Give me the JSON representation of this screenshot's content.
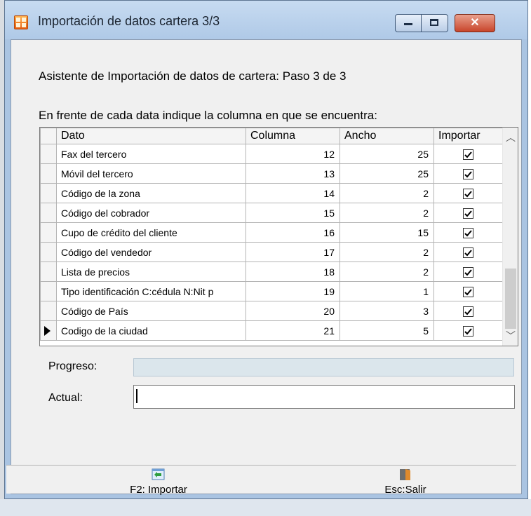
{
  "window": {
    "title": "Importación de datos cartera 3/3",
    "buttons": {
      "minimize": "minimize",
      "maximize": "maximize",
      "close": "close"
    }
  },
  "wizard": {
    "step_text": "Asistente de Importación de datos de cartera: Paso 3 de 3",
    "instruction": "En frente de cada data indique la columna en que se encuentra:"
  },
  "grid": {
    "columns": [
      "Dato",
      "Columna",
      "Ancho",
      "Importar"
    ],
    "rows": [
      {
        "dato": "Fax del tercero",
        "columna": "12",
        "ancho": "25",
        "importar": true,
        "current": false
      },
      {
        "dato": "Móvil del tercero",
        "columna": "13",
        "ancho": "25",
        "importar": true,
        "current": false
      },
      {
        "dato": "Código de la zona",
        "columna": "14",
        "ancho": "2",
        "importar": true,
        "current": false
      },
      {
        "dato": "Código del cobrador",
        "columna": "15",
        "ancho": "2",
        "importar": true,
        "current": false
      },
      {
        "dato": "Cupo de crédito del cliente",
        "columna": "16",
        "ancho": "15",
        "importar": true,
        "current": false
      },
      {
        "dato": "Código del vendedor",
        "columna": "17",
        "ancho": "2",
        "importar": true,
        "current": false
      },
      {
        "dato": "Lista de precios",
        "columna": "18",
        "ancho": "2",
        "importar": true,
        "current": false
      },
      {
        "dato": "Tipo identificación C:cédula N:Nit p",
        "columna": "19",
        "ancho": "1",
        "importar": true,
        "current": false
      },
      {
        "dato": "Código de País",
        "columna": "20",
        "ancho": "3",
        "importar": true,
        "current": false
      },
      {
        "dato": "Codigo de la ciudad",
        "columna": "21",
        "ancho": "5",
        "importar": true,
        "current": true
      }
    ]
  },
  "form": {
    "progress_label": "Progreso:",
    "progress_value": 0,
    "actual_label": "Actual:",
    "actual_value": ""
  },
  "toolbar": {
    "import_label": "F2: Importar",
    "exit_label": "Esc:Salir"
  },
  "colors": {
    "titlebar": "#b9d1ea",
    "close_button": "#c8452b",
    "progress_track": "#dbe6ec"
  }
}
